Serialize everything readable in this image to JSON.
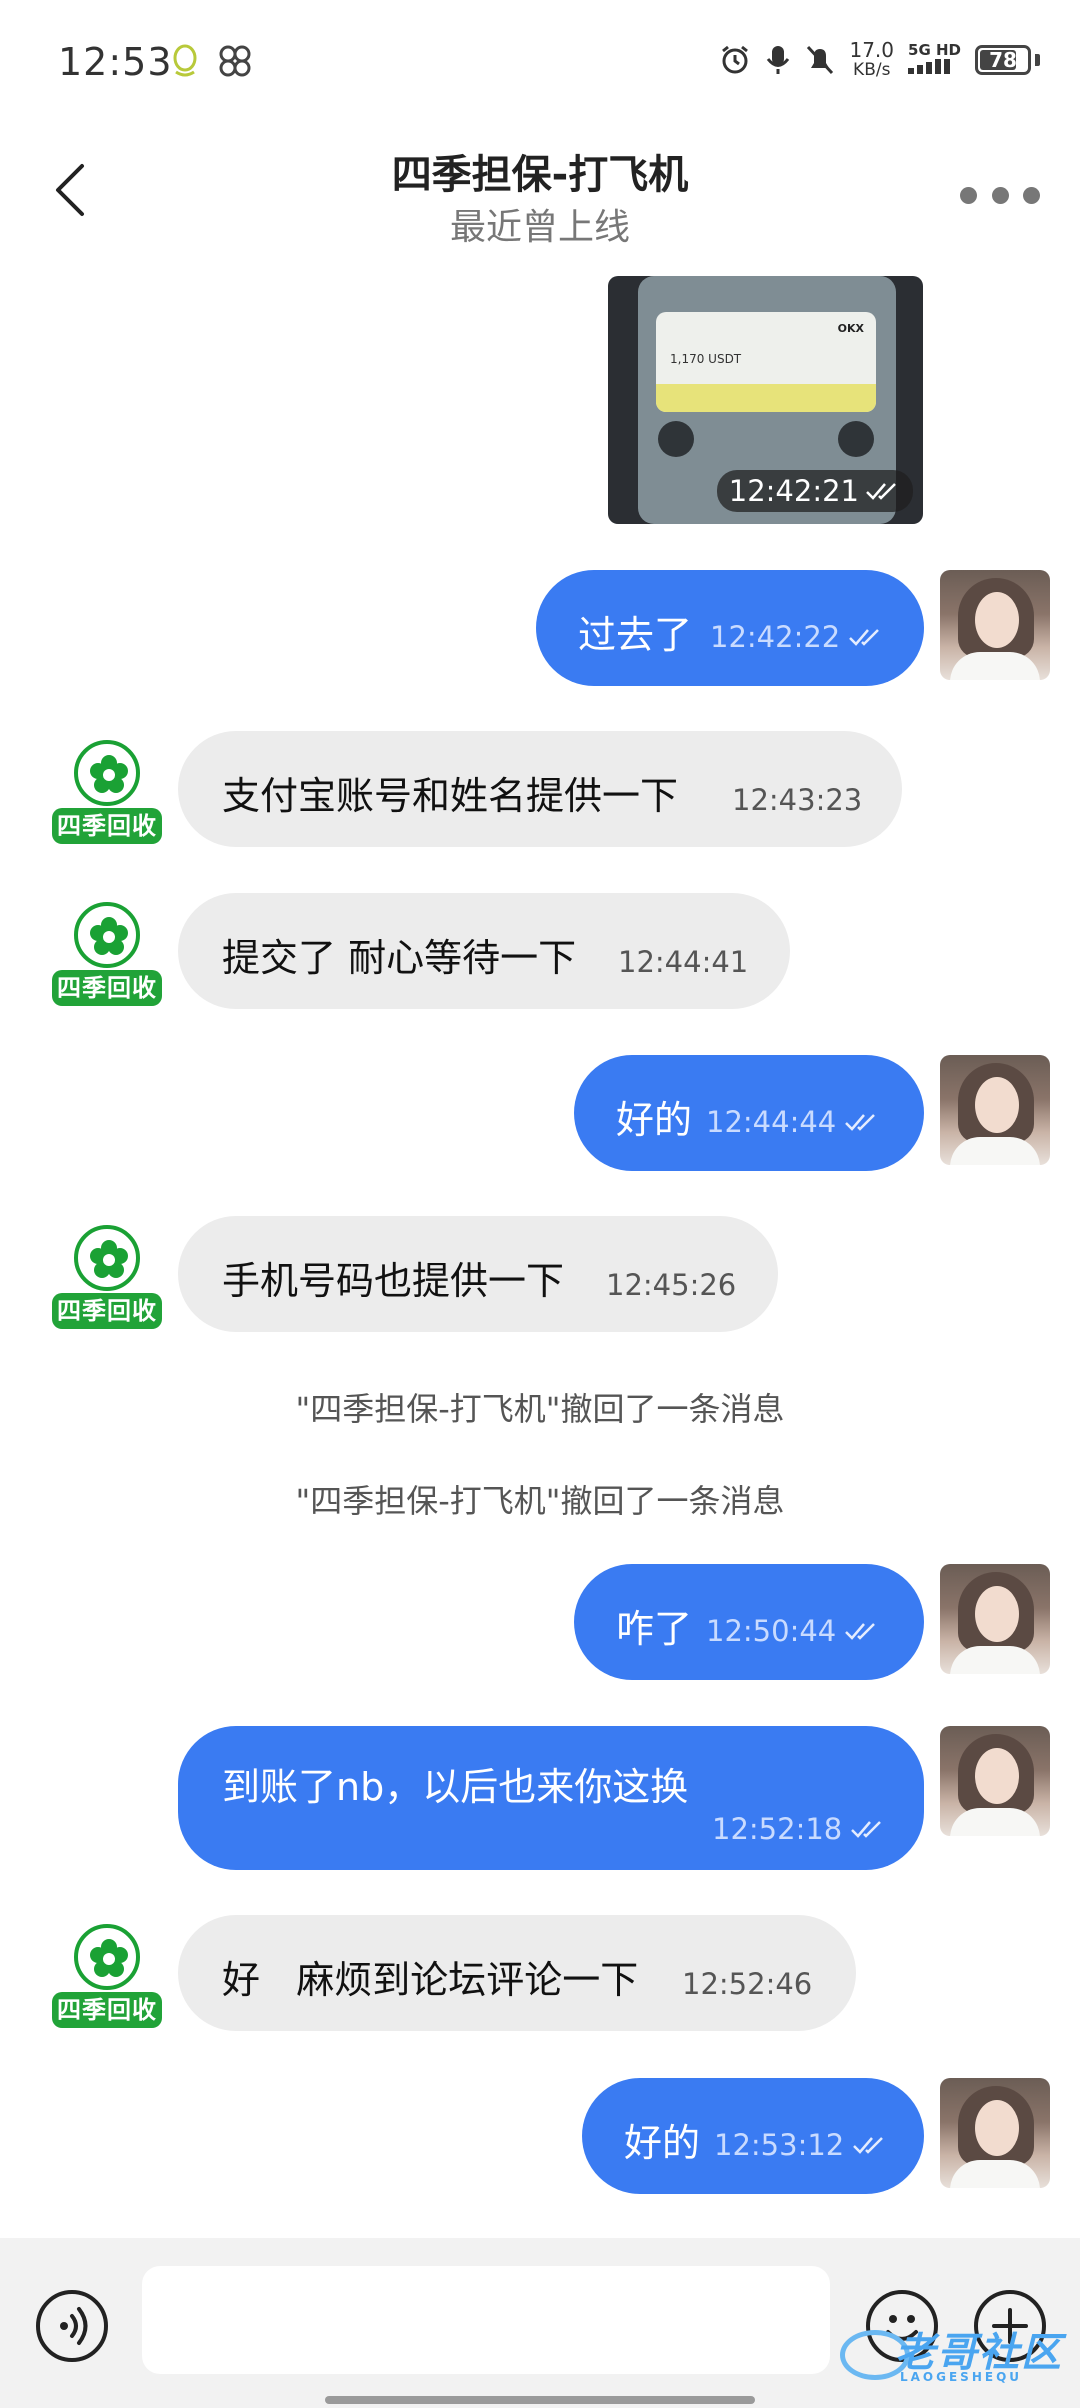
{
  "status_bar": {
    "time": "12:53",
    "speed_value": "17.0",
    "speed_unit": "KB/s",
    "network_top": "5G HD",
    "battery": "78",
    "battery_level": 0.78
  },
  "header": {
    "title": "四季担保-打飞机",
    "subtitle": "最近曾上线"
  },
  "bot_avatar_label": "四季回收",
  "photo_message": {
    "time": "12:42:21",
    "card_amount": "1,170 USDT",
    "card_logo": "OKX"
  },
  "messages": [
    {
      "text": "过去了",
      "time": "12:42:22"
    },
    {
      "text": "支付宝账号和姓名提供一下",
      "time": "12:43:23"
    },
    {
      "text": "提交了 耐心等待一下",
      "time": "12:44:41"
    },
    {
      "text": "好的",
      "time": "12:44:44"
    },
    {
      "text": "手机号码也提供一下",
      "time": "12:45:26"
    },
    {
      "text": "咋了",
      "time": "12:50:44"
    },
    {
      "text": "到账了nb，以后也来你这换",
      "time": "12:52:18"
    },
    {
      "text": "好   麻烦到论坛评论一下",
      "time": "12:52:46"
    },
    {
      "text": "好的",
      "time": "12:53:12"
    }
  ],
  "system_messages": [
    "\"四季担保-打飞机\"撤回了一条消息",
    "\"四季担保-打飞机\"撤回了一条消息"
  ],
  "input": {
    "placeholder": ""
  },
  "watermark": {
    "title": "老哥社区",
    "subtitle": "LAOGESHEQU"
  },
  "colors": {
    "outgoing_bubble": "#3a7bf2",
    "incoming_bubble": "#ececec",
    "bot_green": "#21a338"
  },
  "icons": {
    "back": "chevron-left-icon",
    "more": "more-dots-icon",
    "voice": "voice-icon",
    "emoji": "emoji-icon",
    "plus": "plus-icon",
    "read": "double-check-icon"
  }
}
